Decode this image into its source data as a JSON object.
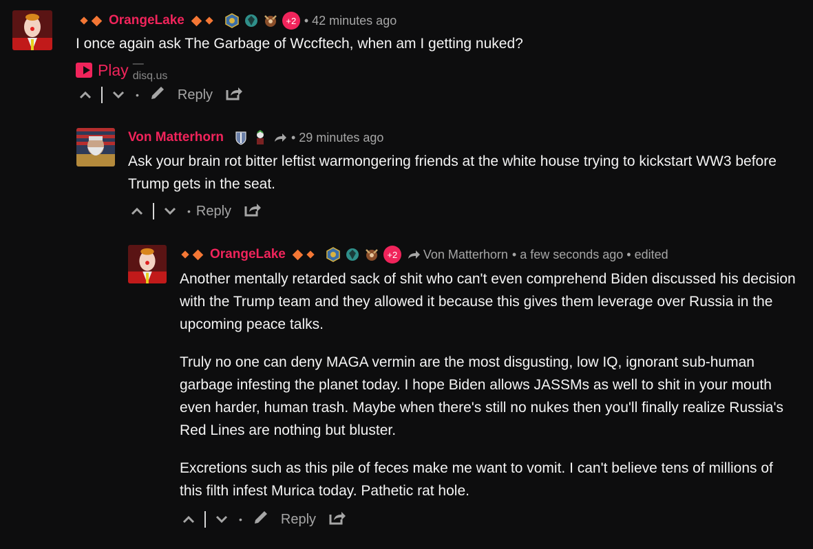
{
  "comments": [
    {
      "author": "OrangeLake",
      "more_badges": "+2",
      "time": "• 42 minutes ago",
      "text": "I once again ask The Garbage of Wccftech, when am I getting nuked?",
      "embed": {
        "label": "Play",
        "source": "— disq.us"
      },
      "actions": {
        "reply": "Reply"
      }
    },
    {
      "author": "Von Matterhorn",
      "time": "• 29 minutes ago",
      "text": "Ask your brain rot bitter leftist warmongering friends at the white house trying to kickstart WW3 before Trump gets in the seat.",
      "actions": {
        "reply": "Reply"
      }
    },
    {
      "author": "OrangeLake",
      "more_badges": "+2",
      "reply_to": "Von Matterhorn",
      "time": "• a few seconds ago • edited",
      "paragraphs": [
        "Another mentally retarded sack of shit who can't even comprehend Biden discussed his decision with the Trump team and they allowed it because this gives them leverage over Russia in the upcoming peace talks.",
        "Truly no one can deny MAGA vermin are the most disgusting, low IQ, ignorant sub-human garbage infesting the planet today. I hope Biden allows JASSMs as well to shit in your mouth even harder, human trash. Maybe when there's still no nukes then you'll finally realize Russia's Red Lines are nothing but bluster.",
        "Excretions such as this pile of feces make me want to vomit. I can't believe tens of millions of this filth infest Murica today. Pathetic rat hole."
      ],
      "actions": {
        "reply": "Reply"
      }
    }
  ],
  "colors": {
    "accent": "#f0245b",
    "diamond": "#f47735",
    "background": "#0d0d0e",
    "meta": "#a6a6a6"
  },
  "icons": [
    "diamond-icon",
    "badge-icon",
    "reply-arrow-icon",
    "upvote-icon",
    "downvote-icon",
    "edit-icon",
    "share-icon",
    "play-icon"
  ]
}
